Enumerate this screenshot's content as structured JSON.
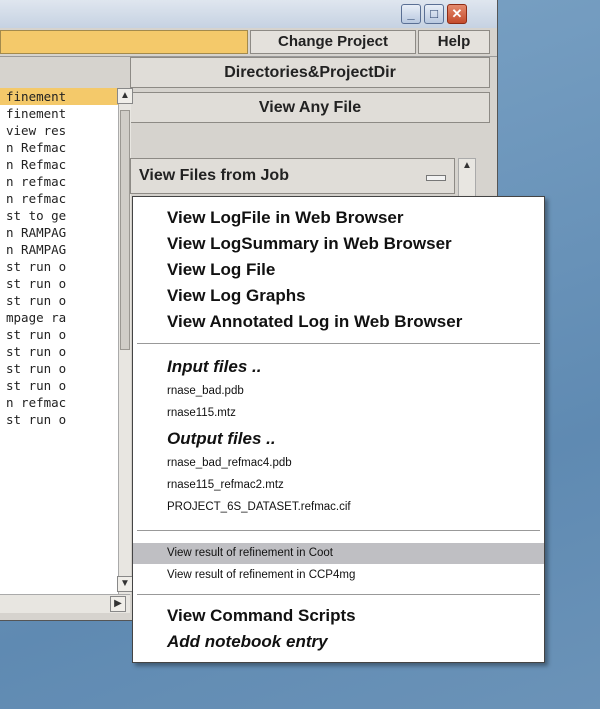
{
  "topbar": {
    "change_project": "Change Project",
    "help": "Help"
  },
  "log_lines": [
    "finement",
    "finement",
    "view res",
    "n Refmac",
    "n Refmac",
    "n refmac",
    "n refmac",
    "st to ge",
    "n RAMPAG",
    "n RAMPAG",
    "st run o",
    "st run o",
    "st run o",
    "mpage ra",
    "st run o",
    "st run o",
    "st run o",
    "st run o",
    "n refmac",
    "st run o"
  ],
  "side_buttons": {
    "directories": "Directories&ProjectDir",
    "view_any_file": "View Any File",
    "view_files_from_job": "View Files from Job"
  },
  "popup_menu": {
    "view_logfile_browser": "View LogFile in Web Browser",
    "view_logsummary_browser": "View LogSummary in Web Browser",
    "view_log_file": "View Log File",
    "view_log_graphs": "View Log Graphs",
    "view_annotated_log": "View Annotated Log in Web Browser",
    "input_files_header": "Input files ..",
    "input_files": [
      "rnase_bad.pdb",
      "rnase115.mtz"
    ],
    "output_files_header": "Output files ..",
    "output_files": [
      "rnase_bad_refmac4.pdb",
      "rnase115_refmac2.mtz",
      "PROJECT_6S_DATASET.refmac.cif"
    ],
    "view_in_coot": "View result of refinement in Coot",
    "view_in_ccp4mg": "View result of refinement in CCP4mg",
    "view_command_scripts": "View Command Scripts",
    "add_notebook_entry": "Add notebook entry"
  }
}
